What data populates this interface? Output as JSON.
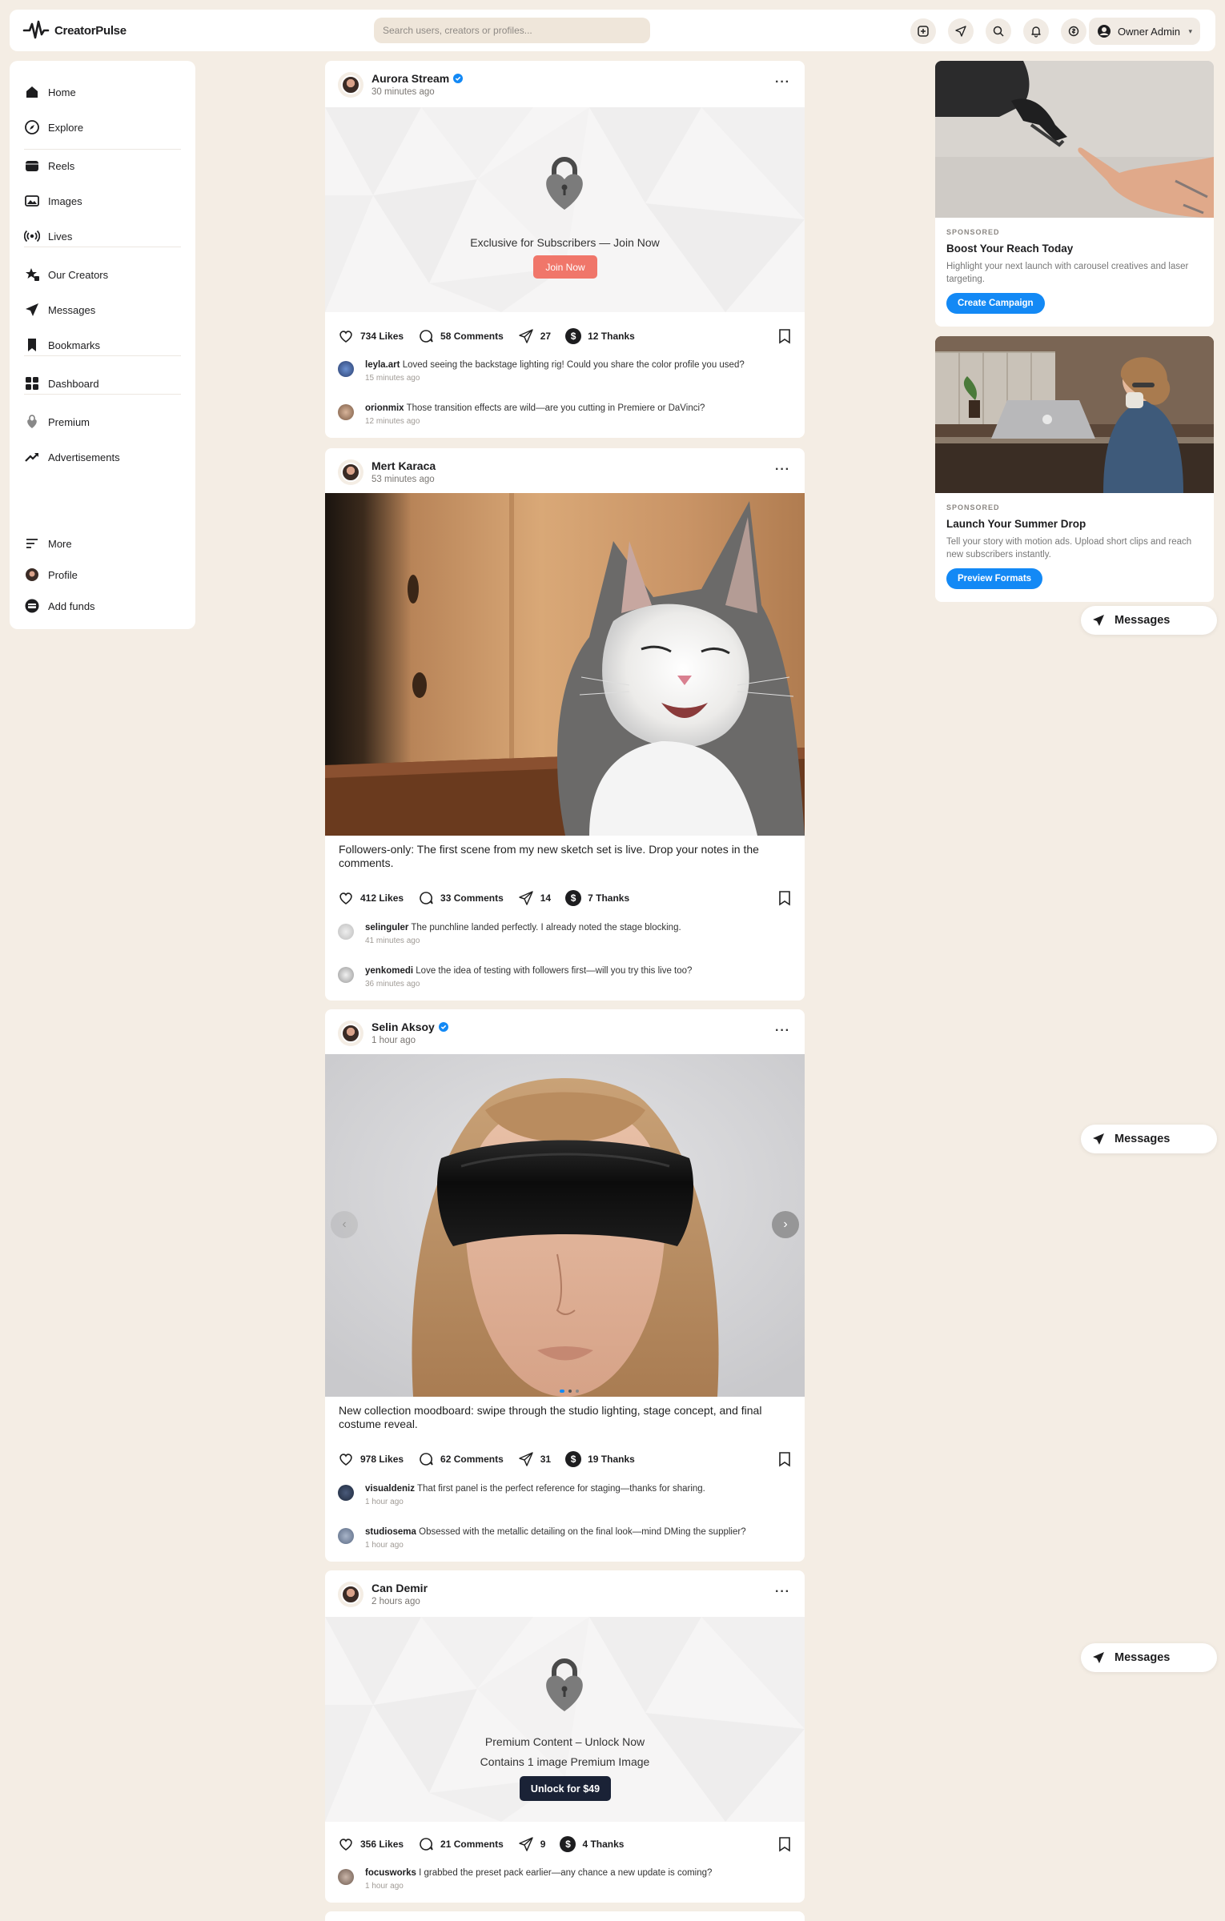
{
  "app": {
    "name": "CreatorPulse"
  },
  "header": {
    "search_placeholder": "Search users, creators or profiles...",
    "user_label": "Owner Admin"
  },
  "sidebar": {
    "items": [
      {
        "label": "Home",
        "icon": "home-icon"
      },
      {
        "label": "Explore",
        "icon": "compass-icon"
      },
      {
        "label": "Reels",
        "icon": "reels-icon"
      },
      {
        "label": "Images",
        "icon": "images-icon"
      },
      {
        "label": "Lives",
        "icon": "broadcast-icon"
      },
      {
        "label": "Our Creators",
        "icon": "creators-star-icon"
      },
      {
        "label": "Messages",
        "icon": "paper-plane-icon"
      },
      {
        "label": "Bookmarks",
        "icon": "bookmark-icon"
      },
      {
        "label": "Dashboard",
        "icon": "dashboard-grid-icon"
      },
      {
        "label": "Premium",
        "icon": "premium-icon"
      },
      {
        "label": "Advertisements",
        "icon": "trending-icon"
      },
      {
        "label": "More",
        "icon": "menu-lines-icon"
      },
      {
        "label": "Profile",
        "icon": "profile-avatar-icon"
      },
      {
        "label": "Add funds",
        "icon": "wallet-icon"
      }
    ]
  },
  "posts": [
    {
      "name": "Aurora Stream",
      "verified": true,
      "time": "30 minutes ago",
      "locked_text": "Exclusive for Subscribers — Join Now",
      "join_label": "Join Now",
      "likes": "734 Likes",
      "comments": "58 Comments",
      "shares": "27",
      "thanks": "12 Thanks",
      "comment_list": [
        {
          "user": "leyla.art",
          "text": "Loved seeing the backstage lighting rig! Could you share the color profile you used?",
          "time": "15 minutes ago"
        },
        {
          "user": "orionmix",
          "text": "Those transition effects are wild—are you cutting in Premiere or DaVinci?",
          "time": "12 minutes ago"
        }
      ]
    },
    {
      "name": "Mert Karaca",
      "verified": false,
      "time": "53 minutes ago",
      "caption": "Followers-only: The first scene from my new sketch set is live. Drop your notes in the comments.",
      "likes": "412 Likes",
      "comments": "33 Comments",
      "shares": "14",
      "thanks": "7 Thanks",
      "comment_list": [
        {
          "user": "selinguler",
          "text": "The punchline landed perfectly. I already noted the stage blocking.",
          "time": "41 minutes ago"
        },
        {
          "user": "yenkomedi",
          "text": "Love the idea of testing with followers first—will you try this live too?",
          "time": "36 minutes ago"
        }
      ]
    },
    {
      "name": "Selin Aksoy",
      "verified": true,
      "time": "1 hour ago",
      "caption": "New collection moodboard: swipe through the studio lighting, stage concept, and final costume reveal.",
      "likes": "978 Likes",
      "comments": "62 Comments",
      "shares": "31",
      "thanks": "19 Thanks",
      "carousel": {
        "slides": 3,
        "active": 1
      },
      "comment_list": [
        {
          "user": "visualdeniz",
          "text": "That first panel is the perfect reference for staging—thanks for sharing.",
          "time": "1 hour ago"
        },
        {
          "user": "studiosema",
          "text": "Obsessed with the metallic detailing on the final look—mind DMing the supplier?",
          "time": "1 hour ago"
        }
      ]
    },
    {
      "name": "Can Demir",
      "verified": false,
      "time": "2 hours ago",
      "locked_text": "Premium Content – Unlock Now",
      "locked_sub": "Contains 1 image Premium Image",
      "unlock_label": "Unlock for $49",
      "likes": "356 Likes",
      "comments": "21 Comments",
      "shares": "9",
      "thanks": "4 Thanks",
      "comment_list": [
        {
          "user": "focusworks",
          "text": "I grabbed the preset pack earlier—any chance a new update is coming?",
          "time": "1 hour ago"
        }
      ]
    }
  ],
  "ads": [
    {
      "sponsored": "SPONSORED",
      "title": "Boost Your Reach Today",
      "body": "Highlight your next launch with carousel creatives and laser targeting.",
      "cta": "Create Campaign"
    },
    {
      "sponsored": "SPONSORED",
      "title": "Launch Your Summer Drop",
      "body": "Tell your story with motion ads. Upload short clips and reach new subscribers instantly.",
      "cta": "Preview Formats"
    }
  ],
  "messages_pill": {
    "label": "Messages"
  },
  "colors": {
    "accent": "#1389f5",
    "join": "#f0766a",
    "unlock": "#1a2236",
    "background": "#f4ede4"
  }
}
